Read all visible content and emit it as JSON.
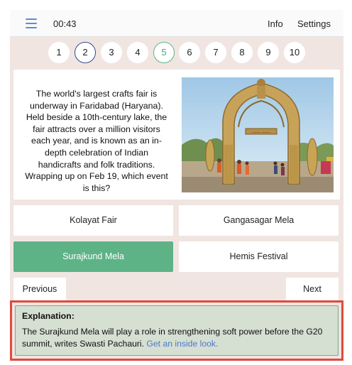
{
  "header": {
    "menu_icon": "hamburger-menu-icon",
    "timer": "00:43",
    "links": {
      "info": "Info",
      "settings": "Settings"
    }
  },
  "question_numbers": [
    {
      "label": "1",
      "state": "normal"
    },
    {
      "label": "2",
      "state": "current"
    },
    {
      "label": "3",
      "state": "normal"
    },
    {
      "label": "4",
      "state": "normal"
    },
    {
      "label": "5",
      "state": "done"
    },
    {
      "label": "6",
      "state": "normal"
    },
    {
      "label": "7",
      "state": "normal"
    },
    {
      "label": "8",
      "state": "normal"
    },
    {
      "label": "9",
      "state": "normal"
    },
    {
      "label": "10",
      "state": "normal"
    }
  ],
  "question": {
    "text": "The world's largest crafts fair is underway in Faridabad (Haryana). Held beside a 10th-century lake, the fair attracts over a million visitors each year, and is known as an in-depth celebration of Indian handicrafts and folk traditions. Wrapping up on Feb 19, which event is this?"
  },
  "options": [
    {
      "label": "Kolayat Fair",
      "state": "normal"
    },
    {
      "label": "Gangasagar Mela",
      "state": "normal"
    },
    {
      "label": "Surajkund Mela",
      "state": "correct"
    },
    {
      "label": "Hemis Festival",
      "state": "normal"
    }
  ],
  "navigation": {
    "previous": "Previous",
    "next": "Next"
  },
  "explanation": {
    "title": "Explanation:",
    "body": "The Surajkund Mela will play a role in strengthening soft power before the G20 summit, writes Swasti Pachauri.",
    "link": "Get an inside look."
  },
  "colors": {
    "accent_blue": "#2c4d8f",
    "correct_green": "#5db386",
    "highlight_red": "#dd4b3e",
    "link_blue": "#4d78c9"
  }
}
